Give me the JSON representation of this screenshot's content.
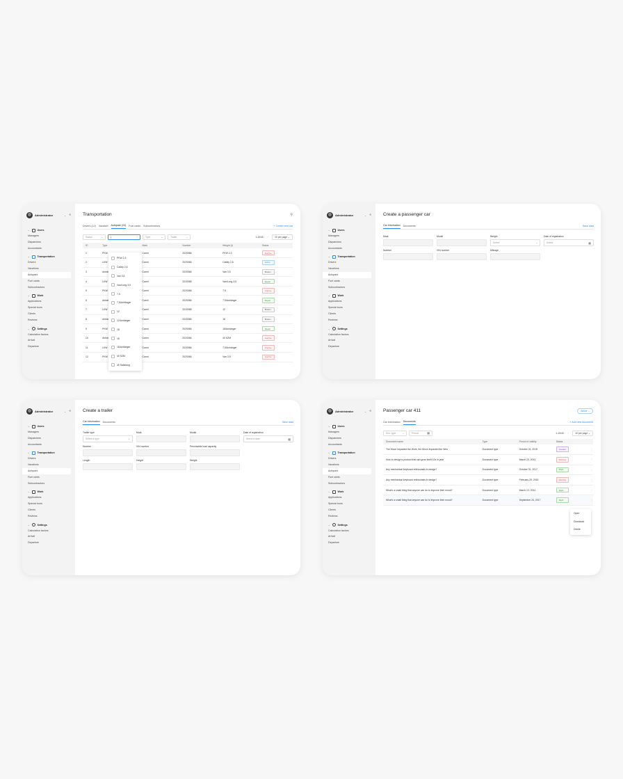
{
  "sidebar": {
    "user": "Administrator",
    "sections": [
      {
        "name": "Users",
        "items": [
          "Managers",
          "Dispatchers",
          "Accountants"
        ]
      },
      {
        "name": "Transportation",
        "items": [
          "Drivers",
          "Vacations",
          "Autopark",
          "Fuel cards",
          "Subcontractors"
        ]
      },
      {
        "name": "Work",
        "items": [
          "Applications",
          "Special tours",
          "Clients",
          "Reviews"
        ]
      },
      {
        "name": "Settings",
        "items": [
          "Calculation factors",
          "Arrival",
          "Departure"
        ]
      }
    ],
    "active_item": "Autopark"
  },
  "transportation": {
    "title": "Transportation",
    "tabs": [
      "Drivers (12)",
      "Vacation",
      "Autopark (24)",
      "Fuel cards",
      "Subcontractors"
    ],
    "active_tab": "Autopark (24)",
    "create_link": "+ Create new car",
    "filters": {
      "status": "Status",
      "search_value": "|",
      "type": "Type",
      "trailer": "Trailer"
    },
    "pager": {
      "range": "1-10/40",
      "prev": "‹",
      "next": "›",
      "per_page": "10 per page"
    },
    "columns": [
      "ID",
      "Type",
      "",
      "Mark",
      "Number",
      "Weight (t)",
      "Status"
    ],
    "rows": [
      {
        "id": "1",
        "type": "PKW",
        "mark": "Camri",
        "number": "2020066",
        "weight": "PKW 2,3",
        "status": "Inactive",
        "tone": "inactive"
      },
      {
        "id": "2",
        "type": "LKW",
        "mark": "Camri",
        "number": "2020066",
        "weight": "Caddy 2,6",
        "status": "Active",
        "tone": "active"
      },
      {
        "id": "3",
        "type": "Anhäng",
        "mark": "Camri",
        "number": "2020066",
        "weight": "Van 3,5",
        "status": "Broken",
        "tone": "broken"
      },
      {
        "id": "4",
        "type": "LKW",
        "mark": "Camri",
        "number": "2020066",
        "weight": "Van/Long 3,5",
        "status": "Repair",
        "tone": "repair"
      },
      {
        "id": "5",
        "type": "PKW",
        "mark": "Camri",
        "number": "2020066",
        "weight": "7,5",
        "status": "Inactive",
        "tone": "inactive"
      },
      {
        "id": "6",
        "type": "Anhäng",
        "mark": "Camri",
        "number": "2020066",
        "weight": "7,5/Anhänger",
        "status": "Repair",
        "tone": "repair"
      },
      {
        "id": "7",
        "type": "LKW",
        "mark": "Camri",
        "number": "2020066",
        "weight": "12",
        "status": "Broken",
        "tone": "broken"
      },
      {
        "id": "8",
        "type": "Anhäng",
        "mark": "Camri",
        "number": "2020066",
        "weight": "18",
        "status": "Broken",
        "tone": "broken"
      },
      {
        "id": "9",
        "type": "PKW",
        "mark": "Camri",
        "number": "2020066",
        "weight": "18/Anhänger",
        "status": "Repair",
        "tone": "repair"
      },
      {
        "id": "10",
        "type": "Anhäng",
        "mark": "Camri",
        "number": "2020066",
        "weight": "40 SZM",
        "status": "Inactive",
        "tone": "inactive"
      },
      {
        "id": "11",
        "type": "LKW",
        "mark": "Camri",
        "number": "2020066",
        "weight": "7,5/Anhänger",
        "status": "Inactive",
        "tone": "inactive"
      },
      {
        "id": "12",
        "type": "PKW",
        "mark": "Camri",
        "number": "2020066",
        "weight": "Van 3,5",
        "status": "Inactive",
        "tone": "inactive"
      }
    ],
    "dropdown_options": [
      "PKW 2,3",
      "Caddy 2,6",
      "Van 3,5",
      "Van/Long 3,5",
      "7,5",
      "7,5/Anhänger",
      "12",
      "12/Anhänger",
      "18",
      "18",
      "18/Anhänger",
      "40 SZM",
      "40 Sattelzug"
    ]
  },
  "passenger_car": {
    "title": "Create a passenger car",
    "tabs": [
      "Car information",
      "Documents"
    ],
    "active_tab": "Car information",
    "save": "Save data",
    "fields": [
      {
        "label": "Mark",
        "value": ""
      },
      {
        "label": "Model",
        "value": ""
      },
      {
        "label": "Weight",
        "value": "Select"
      },
      {
        "label": "Date of registration",
        "value": "Select"
      },
      {
        "label": "Number",
        "value": ""
      },
      {
        "label": "VIN number",
        "value": ""
      },
      {
        "label": "Mileage",
        "value": ""
      }
    ]
  },
  "trailer": {
    "title": "Create a trailer",
    "tabs": [
      "Car information",
      "Documents"
    ],
    "active_tab": "Car information",
    "save": "Save data",
    "fields": [
      {
        "label": "Trailer type",
        "value": "Select a type"
      },
      {
        "label": "Mark",
        "value": ""
      },
      {
        "label": "Model",
        "value": ""
      },
      {
        "label": "Date of registration",
        "value": "Select a date"
      },
      {
        "label": "Number",
        "value": ""
      },
      {
        "label": "VIN number",
        "value": ""
      },
      {
        "label": "Permissible load capacity",
        "value": ""
      },
      {
        "label": "Length",
        "value": ""
      },
      {
        "label": "Height",
        "value": ""
      },
      {
        "label": "Weight",
        "value": ""
      }
    ]
  },
  "car411": {
    "title": "Passenger car 411",
    "status": "Active",
    "tabs": [
      "Car information",
      "Documents"
    ],
    "active_tab": "Documents",
    "add_link": "+ Add new document",
    "filters": {
      "doc_type": "Doc. type",
      "period": "Period"
    },
    "pager": {
      "range": "1-10/40",
      "prev": "‹",
      "next": "›",
      "per_page": "10 per page"
    },
    "columns": [
      "Document name",
      "Type",
      "Period of validity",
      "Status"
    ],
    "rows": [
      {
        "name": "The Moon Impacted the Work, the Moon Impacted the New",
        "type": "Document type",
        "period": "October 24, 2015",
        "status": "Created",
        "tone": "created"
      },
      {
        "name": "How to design a product that can grow itself 10x in year",
        "type": "Document type",
        "period": "March 23, 2013",
        "status": "Warning",
        "tone": "warning"
      },
      {
        "name": "Any mechanical keyboard enthusiasts in design?",
        "type": "Document type",
        "period": "October 31, 2017",
        "status": "Right",
        "tone": "right"
      },
      {
        "name": "Any mechanical keyboard enthusiasts in design?",
        "type": "Document type",
        "period": "February 29, 2015",
        "status": "Warning",
        "tone": "warning"
      },
      {
        "name": "What's a small thing that anyone can do to improve their mood?",
        "type": "Document type",
        "period": "March 13, 2014",
        "status": "Right",
        "tone": "right"
      },
      {
        "name": "What's a small thing that anyone can do to improve their mood?",
        "type": "Document type",
        "period": "September 24, 2017",
        "status": "Right",
        "tone": "right"
      }
    ],
    "context_menu": [
      "Open",
      "Download",
      "Delete"
    ]
  }
}
